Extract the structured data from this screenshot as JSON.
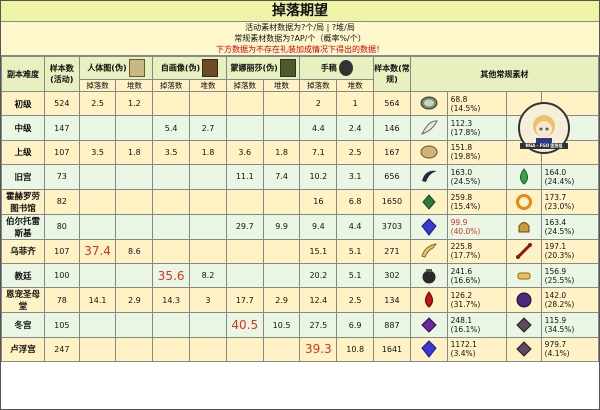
{
  "title": "掉落期望",
  "info": [
    "活动素材数据为?个/局 | ?堆/局",
    "常规素材数据为?AP/个（概率%/个）",
    "下方数据为不存在礼装加成情况下得出的数据！"
  ],
  "headers": {
    "stage": "副本难度",
    "samples_event": "样本数(活动)",
    "items": [
      "人体图(伪)",
      "自画像(伪)",
      "蒙娜丽莎(伪)",
      "手稿"
    ],
    "drop": "掉落数",
    "stack": "堆数",
    "samples_normal": "样本数(常规)",
    "other_materials": "其他常规素材"
  },
  "emblem_text": "NGA - FGO 团员组",
  "rows": [
    {
      "stage": "初级",
      "samples": "524",
      "v": [
        "2.5",
        "1.2",
        "",
        "",
        "",
        "",
        "2",
        "1"
      ],
      "n": "564",
      "m1": "68.8",
      "p1": "(14.5%)",
      "m2": "",
      "p2": ""
    },
    {
      "stage": "中级",
      "samples": "147",
      "v": [
        "",
        "",
        "5.4",
        "2.7",
        "",
        "",
        "4.4",
        "2.4"
      ],
      "n": "146",
      "m1": "112.3",
      "p1": "(17.8%)",
      "m2": "",
      "p2": ""
    },
    {
      "stage": "上级",
      "samples": "107",
      "v": [
        "3.5",
        "1.8",
        "3.5",
        "1.8",
        "3.6",
        "1.8",
        "7.1",
        "2.5"
      ],
      "n": "167",
      "m1": "151.8",
      "p1": "(19.8%)",
      "m2": "",
      "p2": ""
    },
    {
      "stage": "旧宫",
      "samples": "73",
      "v": [
        "",
        "",
        "",
        "",
        "11.1",
        "7.4",
        "10.2",
        "3.1"
      ],
      "n": "656",
      "m1": "163.0",
      "p1": "(24.5%)",
      "m2": "164.0",
      "p2": "(24.4%)"
    },
    {
      "stage": "霍赫罗劳图书馆",
      "samples": "82",
      "v": [
        "",
        "",
        "",
        "",
        "",
        "",
        "16",
        "6.8"
      ],
      "n": "1650",
      "m1": "259.8",
      "p1": "(15.4%)",
      "m2": "173.7",
      "p2": "(23.0%)"
    },
    {
      "stage": "伯尔托雷斯基",
      "samples": "80",
      "v": [
        "",
        "",
        "",
        "",
        "29.7",
        "9.9",
        "9.4",
        "4.4"
      ],
      "n": "3703",
      "m1": "99.9",
      "p1": "(40.0%)",
      "m2": "163.4",
      "p2": "(24.5%)",
      "m1red": true
    },
    {
      "stage": "乌菲齐",
      "samples": "107",
      "v": [
        "37.4",
        "8.6",
        "",
        "",
        "",
        "",
        "15.1",
        "5.1"
      ],
      "n": "271",
      "m1": "225.8",
      "p1": "(17.7%)",
      "m2": "197.1",
      "p2": "(20.3%)",
      "big": 0
    },
    {
      "stage": "教廷",
      "samples": "100",
      "v": [
        "",
        "",
        "35.6",
        "8.2",
        "",
        "",
        "20.2",
        "5.1"
      ],
      "n": "302",
      "m1": "241.6",
      "p1": "(16.6%)",
      "m2": "156.9",
      "p2": "(25.5%)",
      "big": 2
    },
    {
      "stage": "恩宠圣母堂",
      "samples": "78",
      "v": [
        "14.1",
        "2.9",
        "14.3",
        "3",
        "17.7",
        "2.9",
        "12.4",
        "2.5"
      ],
      "n": "134",
      "m1": "126.2",
      "p1": "(31.7%)",
      "m2": "142.0",
      "p2": "(28.2%)"
    },
    {
      "stage": "冬宫",
      "samples": "105",
      "v": [
        "",
        "",
        "",
        "",
        "40.5",
        "10.5",
        "27.5",
        "6.9"
      ],
      "n": "887",
      "m1": "248.1",
      "p1": "(16.1%)",
      "m2": "115.9",
      "p2": "(34.5%)",
      "big": 4
    },
    {
      "stage": "卢浮宫",
      "samples": "247",
      "v": [
        "",
        "",
        "",
        "",
        "",
        "",
        "39.3",
        "10.8"
      ],
      "n": "1641",
      "m1": "1172.1",
      "p1": "(3.4%)",
      "m2": "979.7",
      "p2": "(4.1%)",
      "big": 6
    }
  ],
  "colors": {
    "header": "#e7f0bf",
    "row_yellow": "#fff3c6",
    "row_green": "#eaf7e4",
    "highlight": "#e0301e"
  },
  "icons": {
    "m1": [
      "hand-mirror-icon",
      "feather-icon",
      "scale-shell-icon",
      "claw-icon",
      "green-leaf-icon",
      "blue-crystal-icon",
      "horn-icon",
      "black-pot-icon",
      "red-drop-icon",
      "purple-gem-icon",
      "blue-crystal-icon"
    ],
    "m2": [
      "",
      "",
      "",
      "green-drop-icon",
      "gear-ring-icon",
      "bell-icon",
      "bone-icon",
      "golden-tube-icon",
      "purple-orb-icon",
      "gray-gem-icon",
      "gray-gem-icon"
    ]
  }
}
